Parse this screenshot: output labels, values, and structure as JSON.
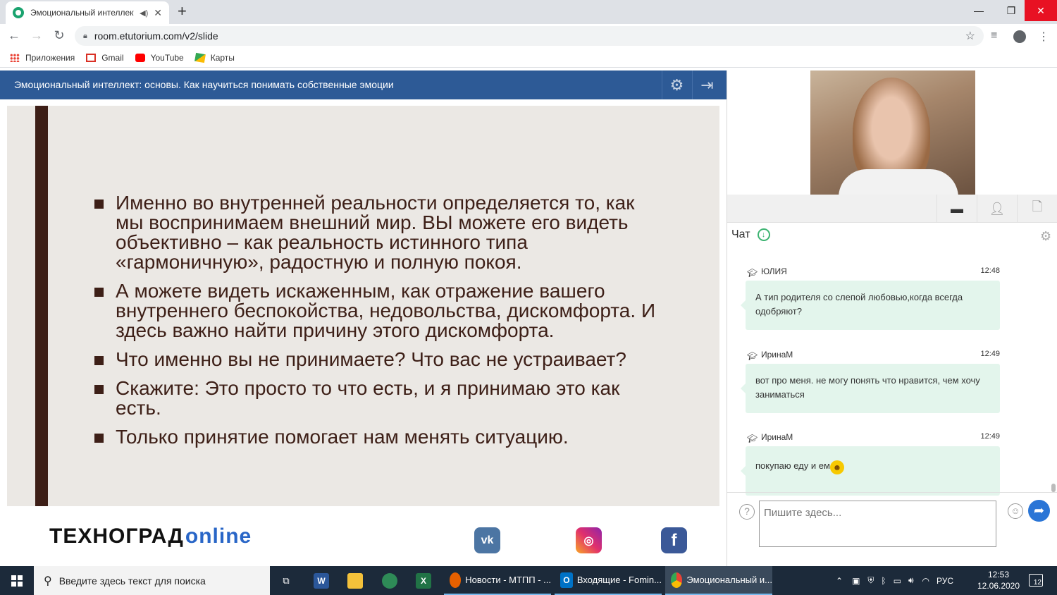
{
  "browser": {
    "tab_title": "Эмоциональный интеллект",
    "url": "room.etutorium.com/v2/slide",
    "bookmarks": [
      "Приложения",
      "Gmail",
      "YouTube",
      "Карты"
    ]
  },
  "app": {
    "title": "Эмоциональный интеллект: основы. Как научиться понимать собственные эмоции"
  },
  "slide": {
    "bullets": [
      "Именно во внутренней реальности определяется то, как мы воспринимаем внешний мир. ВЫ можете его видеть объективно – как реальность истинного типа «гармоничную», радостную и полную покоя.",
      "А можете видеть искаженным, как отражение вашего внутреннего беспокойства, недовольства, дискомфорта. И здесь важно найти причину этого дискомфорта.",
      "Что именно вы не принимаете? Что вас не устраивает?",
      "Скажите: Это просто то что есть, и я принимаю это как есть.",
      "Только принятие помогает нам менять ситуацию."
    ],
    "logo_main": "ТЕХНОГРАД",
    "logo_sub": "online"
  },
  "chat": {
    "title": "Чат",
    "messages": [
      {
        "author": "ЮЛИЯ",
        "time": "12:48",
        "text": "А тип родителя со слепой любовью,когда всегда одобряют?"
      },
      {
        "author": "ИринаМ",
        "time": "12:49",
        "text": "вот про меня. не могу понять что нравится, чем хочу заниматься"
      },
      {
        "author": "ИринаМ",
        "time": "12:49",
        "text": "покупаю еду и ем"
      }
    ],
    "input_placeholder": "Пишите здесь..."
  },
  "taskbar": {
    "search_placeholder": "Введите здесь текст для поиска",
    "apps": [
      {
        "label": "Новости - МТПП - ..."
      },
      {
        "label": "Входящие - Fomin..."
      },
      {
        "label": "Эмоциональный и..."
      }
    ],
    "language": "РУС",
    "time": "12:53",
    "date": "12.06.2020",
    "notifications": "12"
  }
}
